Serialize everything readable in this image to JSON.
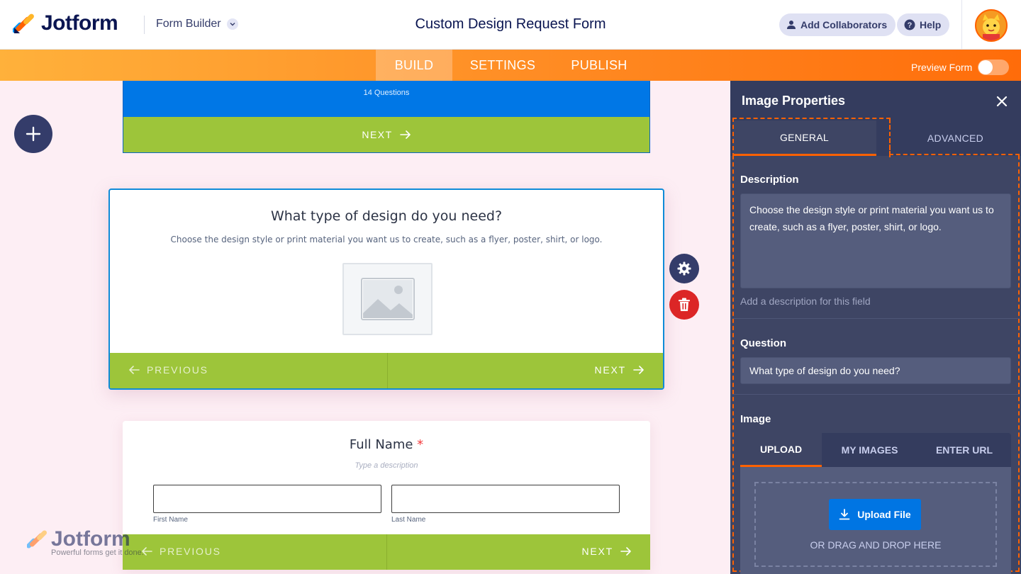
{
  "header": {
    "brand": "Jotform",
    "form_builder_label": "Form Builder",
    "form_title": "Custom Design Request Form",
    "add_collaborators": "Add Collaborators",
    "help": "Help"
  },
  "nav": {
    "tabs": [
      "BUILD",
      "SETTINGS",
      "PUBLISH"
    ],
    "active_tab": "BUILD",
    "preview_label": "Preview Form",
    "preview_on": false
  },
  "canvas": {
    "welcome_card": {
      "questions_count": "14 Questions",
      "next_label": "NEXT"
    },
    "image_card": {
      "title": "What type of design do you need?",
      "description": "Choose the design style or print material you want us to create, such as a flyer, poster, shirt, or logo.",
      "previous_label": "PREVIOUS",
      "next_label": "NEXT"
    },
    "name_card": {
      "title": "Full Name",
      "required_mark": "*",
      "description_placeholder": "Type a description",
      "first_name_label": "First Name",
      "last_name_label": "Last Name",
      "previous_label": "PREVIOUS",
      "next_label": "NEXT"
    },
    "watermark": {
      "brand": "Jotform",
      "tagline": "Powerful forms get it done."
    }
  },
  "panel": {
    "title": "Image Properties",
    "tabs": [
      "GENERAL",
      "ADVANCED"
    ],
    "active_tab": "GENERAL",
    "description_label": "Description",
    "description_value": "Choose the design style or print material you want us to create, such as a flyer, poster, shirt, or logo.",
    "description_hint": "Add a description for this field",
    "question_label": "Question",
    "question_value": "What type of design do you need?",
    "image_label": "Image",
    "image_tabs": [
      "UPLOAD",
      "MY IMAGES",
      "ENTER URL"
    ],
    "active_image_tab": "UPLOAD",
    "upload_button": "Upload File",
    "drop_text": "OR DRAG AND DROP HERE"
  },
  "colors": {
    "brand_orange": "#ff6100",
    "nav_gradient_start": "#ffb13b",
    "nav_gradient_end": "#ff6c0a",
    "page_bg": "#fdeef4",
    "panel_bg": "#3e4564",
    "button_green": "#9dc53a",
    "welcome_blue": "#0077e6",
    "upload_blue": "#0075e3",
    "delete_red": "#dc2626"
  },
  "icons": [
    "jotform-logo-icon",
    "chevron-down-icon",
    "user-icon",
    "help-icon",
    "avatar-icon",
    "plus-icon",
    "arrow-right-icon",
    "arrow-left-icon",
    "image-placeholder-icon",
    "gear-icon",
    "trash-icon",
    "close-icon",
    "download-icon"
  ]
}
